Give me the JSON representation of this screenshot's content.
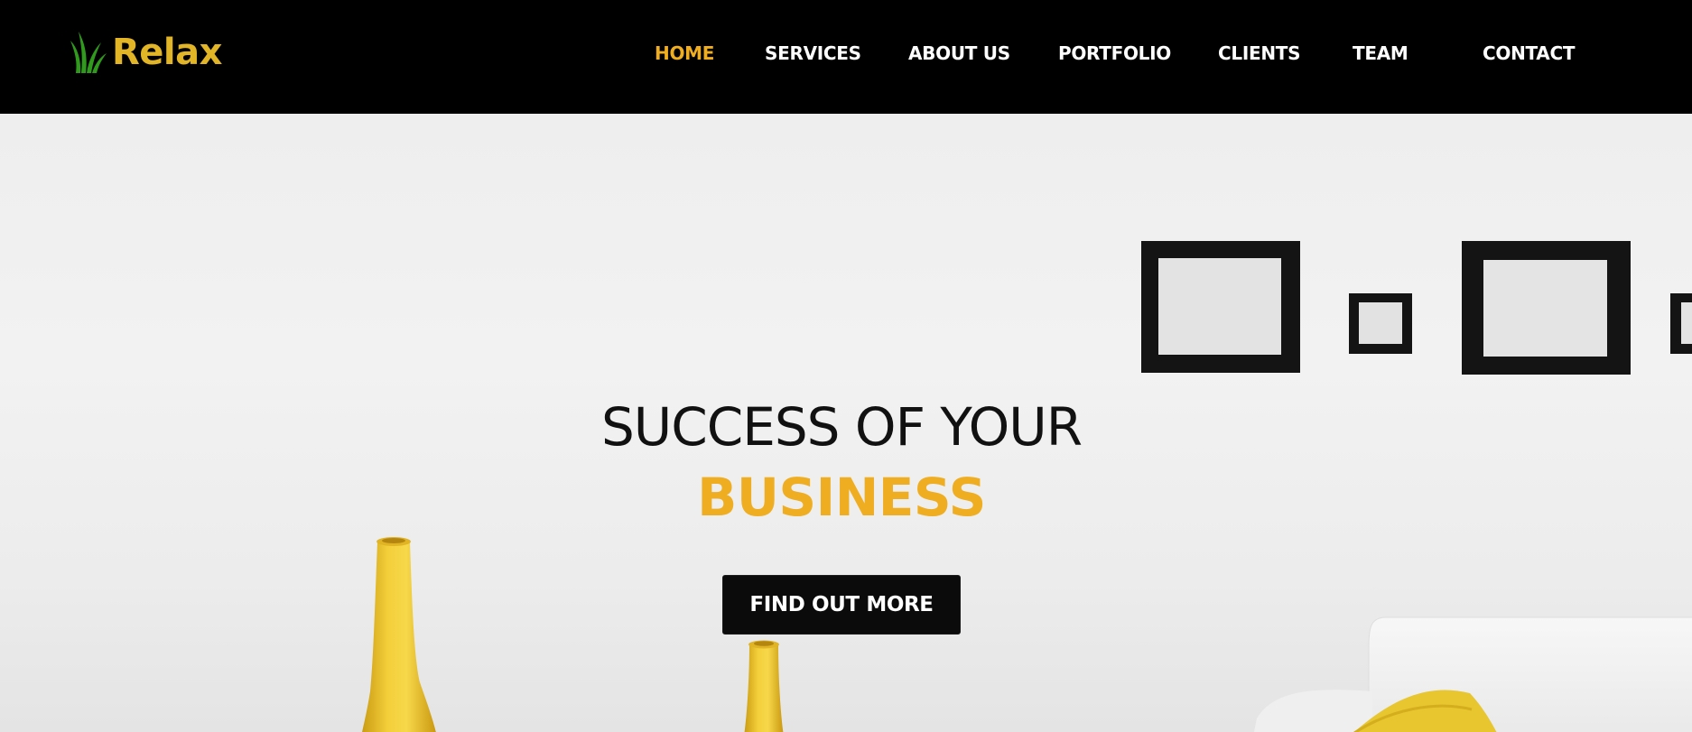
{
  "brand": {
    "name": "Relax",
    "logo_icon": "grass-leaf-icon",
    "text_color": "#e2b526",
    "icon_color": "#2f9a1c"
  },
  "nav": {
    "items": [
      {
        "label": "HOME",
        "active": true
      },
      {
        "label": "SERVICES",
        "active": false
      },
      {
        "label": "ABOUT US",
        "active": false
      },
      {
        "label": "PORTFOLIO",
        "active": false
      },
      {
        "label": "CLIENTS",
        "active": false
      },
      {
        "label": "TEAM",
        "active": false
      },
      {
        "label": "CONTACT",
        "active": false
      }
    ],
    "active_color": "#f0ad1e",
    "default_color": "#ffffff"
  },
  "hero": {
    "title_line1": "SUCCESS OF YOUR",
    "title_line2": "BUSINESS",
    "accent_color": "#efad22",
    "cta_label": "FIND OUT MORE",
    "background_image": "white wall with black square frames and yellow vases"
  }
}
